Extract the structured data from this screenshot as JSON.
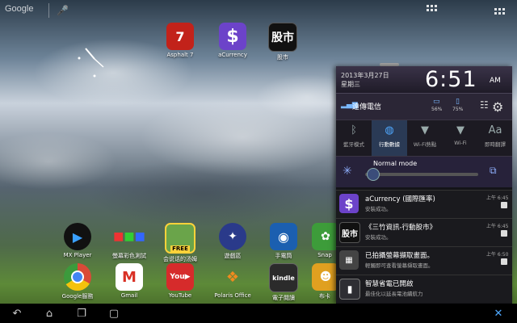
{
  "topbar": {
    "search_label": "Google",
    "mic_icon": "microphone-icon",
    "apps_icon": "apps-grid-icon"
  },
  "clock_widget": "analog-clock",
  "home_top_apps": [
    {
      "label": "Asphalt 7",
      "icon": "car-icon",
      "color": "#c2221a"
    },
    {
      "label": "aCurrency",
      "icon": "dollar-icon",
      "color": "#6c43c9"
    },
    {
      "label": "股市",
      "icon": "text-icon",
      "color": "#111111"
    }
  ],
  "dock_row1": [
    {
      "label": "MX Player",
      "icon": "play-icon",
      "color": "#1c6fd1"
    },
    {
      "label": "螢幕彩色測試",
      "icon": "cubes-icon",
      "color": "#d13a2a"
    },
    {
      "label": "会说话的汤姆",
      "icon": "cat-icon",
      "color": "#6aa44a",
      "badge": "FREE"
    },
    {
      "label": "遊戲區",
      "icon": "game-icon",
      "color": "#2a3a8a"
    },
    {
      "label": "手電筒",
      "icon": "flashlight-icon",
      "color": "#1b5fb0"
    },
    {
      "label": "Snap",
      "icon": "leaf-icon",
      "color": "#3d9c3a"
    }
  ],
  "dock_row2": [
    {
      "label": "Google服務",
      "icon": "chrome-icon",
      "color": "#d94a38"
    },
    {
      "label": "Gmail",
      "icon": "gmail-icon",
      "color": "#ffffff"
    },
    {
      "label": "YouTube",
      "icon": "youtube-icon",
      "color": "#d62b2b"
    },
    {
      "label": "Polaris Office",
      "icon": "office-icon",
      "color": "#f08a1e"
    },
    {
      "label": "電子閱讀",
      "icon": "kindle-icon",
      "color": "#2b2b2b"
    },
    {
      "label": "布卡",
      "icon": "reader-icon",
      "color": "#e0a020"
    }
  ],
  "navbar": {
    "back_icon": "back-icon",
    "home_icon": "home-icon",
    "recents_icon": "recents-icon",
    "screenshot_icon": "screenshot-icon",
    "close_icon": "close-icon"
  },
  "panel": {
    "date": "2013年3月27日",
    "day": "星期三",
    "time": "6:51",
    "ampm": "AM",
    "carrier": "遠傳電信",
    "battery_tablet": "56%",
    "battery_dock": "75%",
    "toggles": [
      {
        "label": "藍牙模式",
        "icon": "bluetooth-icon",
        "on": false
      },
      {
        "label": "行動數據",
        "icon": "globe-icon",
        "on": true
      },
      {
        "label": "Wi-Fi熱點",
        "icon": "wifi-hotspot-icon",
        "on": false
      },
      {
        "label": "Wi-Fi",
        "icon": "wifi-icon",
        "on": false
      },
      {
        "label": "即時翻譯",
        "icon": "translate-icon",
        "on": false
      }
    ],
    "mode": {
      "name": "Normal mode",
      "brightness": 0.05
    },
    "notifications": [
      {
        "title": "aCurrency (國際匯率)",
        "sub": "安裝成功。",
        "time": "上午 6:45",
        "icon": "dollar-icon",
        "color": "#6c43c9"
      },
      {
        "title": "《三竹資訊-行動股市》",
        "sub": "安裝成功。",
        "time": "上午 6:45",
        "icon": "text-icon",
        "color": "#111111",
        "glyph": "股市"
      },
      {
        "title": "已拍攝螢幕擷取畫面。",
        "sub": "輕觸即可查看螢幕擷取畫面。",
        "time": "上午 6:50",
        "icon": "screenshot-icon",
        "color": "#444444"
      },
      {
        "title": "智慧省電已開啟",
        "sub": "最佳化以延長電池續航力",
        "time": "",
        "icon": "battery-leaf-icon",
        "color": "#2e2e33"
      }
    ]
  }
}
